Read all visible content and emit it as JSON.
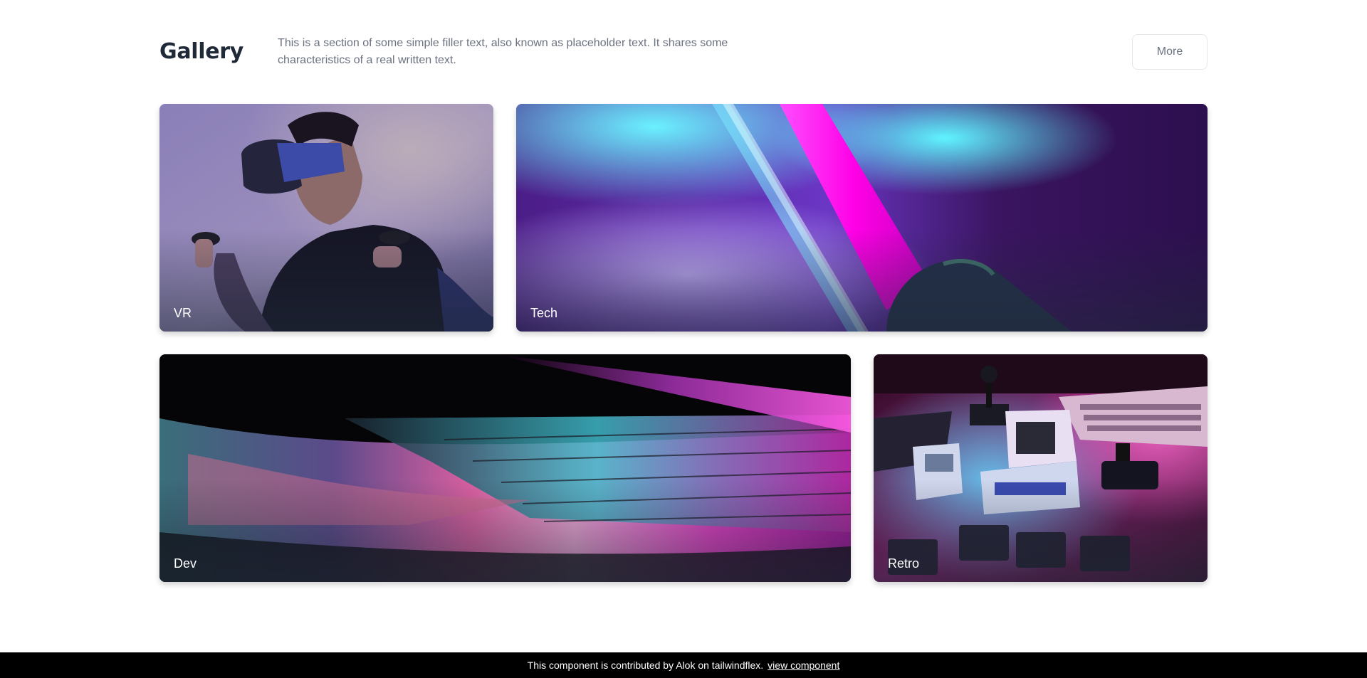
{
  "header": {
    "title": "Gallery",
    "description": "This is a section of some simple filler text, also known as placeholder text. It shares some characteristics of a real written text.",
    "more_label": "More"
  },
  "gallery": {
    "cards": [
      {
        "label": "VR"
      },
      {
        "label": "Tech"
      },
      {
        "label": "Dev"
      },
      {
        "label": "Retro"
      }
    ]
  },
  "footer": {
    "text": "This component is contributed by Alok on tailwindflex.",
    "link_label": "view component"
  },
  "colors": {
    "title": "#1f2937",
    "description": "#6b7280",
    "footer_bg": "#000000",
    "accent_pink": "#ff00e6",
    "accent_cyan": "#4fe8ff",
    "accent_purple": "#5b2a8c"
  }
}
